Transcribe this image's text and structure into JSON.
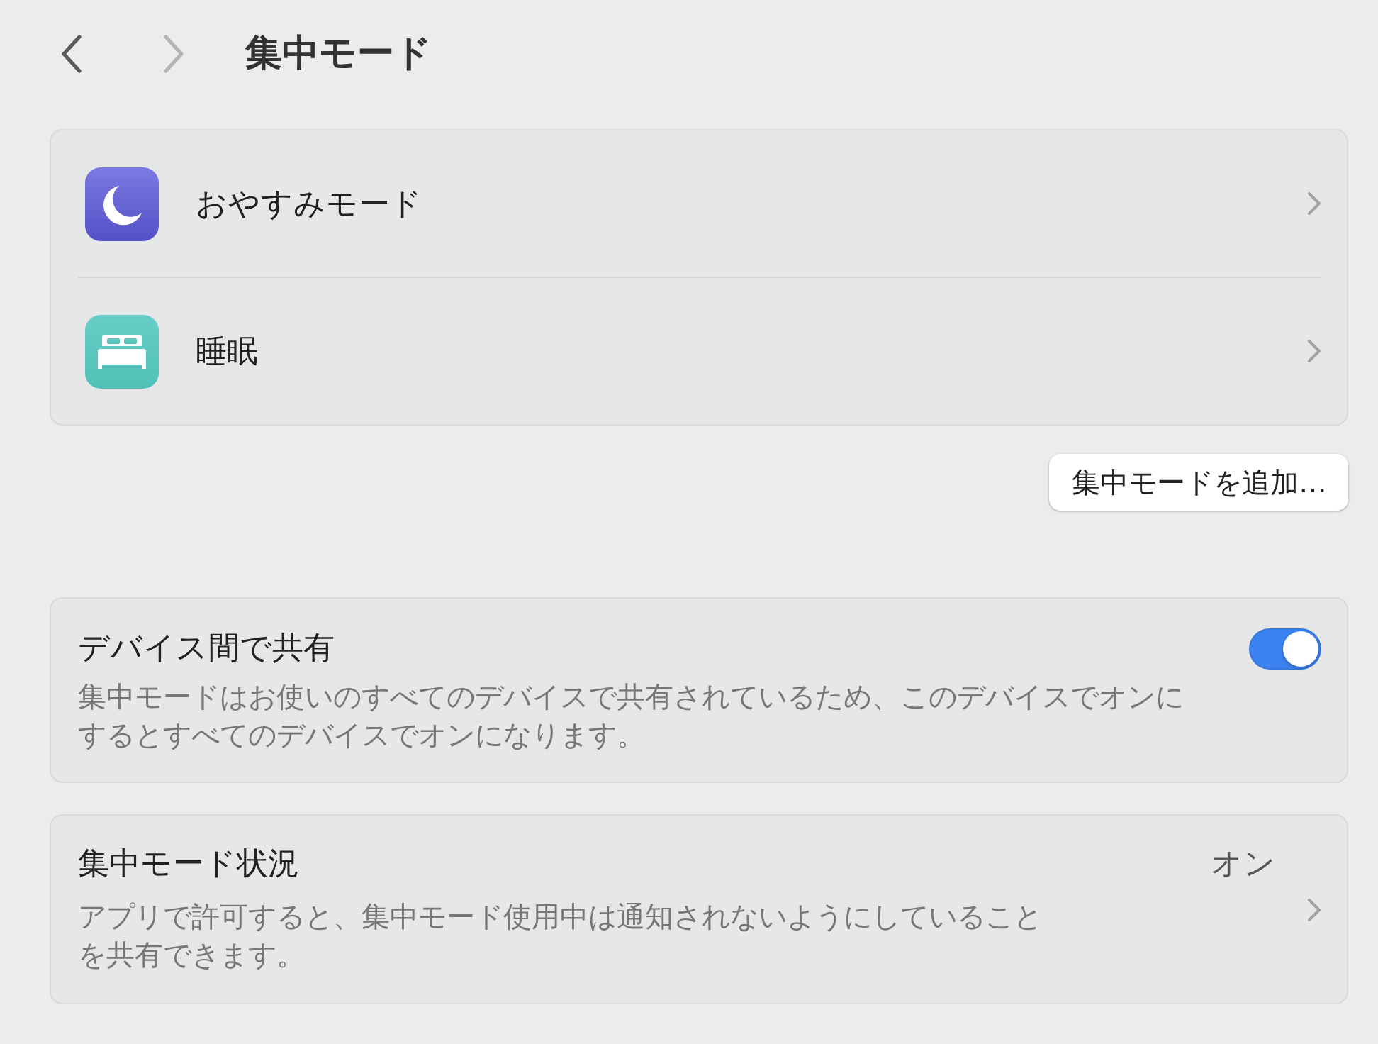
{
  "navigation": [
    {
      "kind": "back",
      "disabled": false
    },
    {
      "kind": "forward",
      "disabled": true
    }
  ],
  "title": "集中モード",
  "focus_modes": [
    {
      "kind": "moon",
      "label": "おやすみモード"
    },
    {
      "kind": "bed",
      "label": "睡眠"
    }
  ],
  "add_button": "集中モードを追加…",
  "share_across_devices": {
    "title": "デバイス間で共有",
    "description": "集中モードはお使いのすべてのデバイスで共有されているため、このデバイスでオンにするとすべてのデバイスでオンになります。",
    "on": true
  },
  "focus_status": {
    "title": "集中モード状況",
    "value": "オン",
    "description": "アプリで許可すると、集中モード使用中は通知されないようにしていることを共有できます。"
  }
}
